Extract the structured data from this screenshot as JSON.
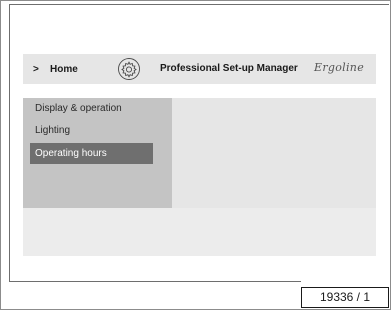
{
  "header": {
    "breadcrumb_chevron": ">",
    "home_label": "Home",
    "settings_icon": "gear-icon",
    "title": "Professional Set-up Manager",
    "brand": "Ergoline"
  },
  "menu": {
    "items": [
      {
        "label": "Display & operation",
        "selected": false
      },
      {
        "label": "Lighting",
        "selected": false
      },
      {
        "label": "Operating hours",
        "selected": true
      }
    ]
  },
  "figure_ref": "19336 / 1",
  "colors": {
    "header_bg": "#e6e6e6",
    "menu_bg": "#c4c4c4",
    "selected_bg": "#6f6f6f",
    "content_bg": "#e6e6e6"
  }
}
